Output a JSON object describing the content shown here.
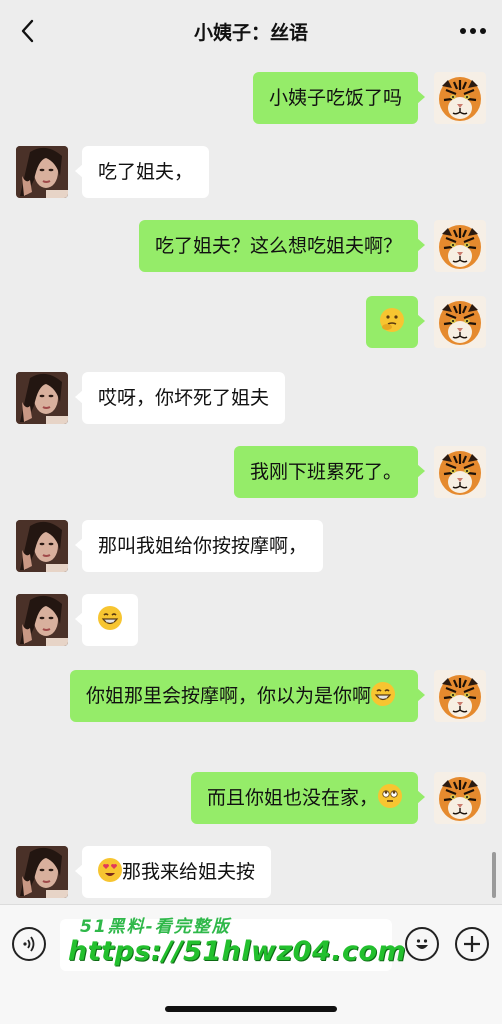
{
  "header": {
    "title": "小姨子：丝语",
    "back_icon": "chevron-left-icon",
    "more_icon": "more-dots-icon"
  },
  "messages": [
    {
      "side": "out",
      "text": "小姨子吃饭了吗"
    },
    {
      "side": "in",
      "text": "吃了姐夫，"
    },
    {
      "side": "out",
      "text": "吃了姐夫？这么想吃姐夫啊？"
    },
    {
      "side": "out",
      "text": "",
      "emoji": "thinking-face-emoji"
    },
    {
      "side": "in",
      "text": "哎呀，你坏死了姐夫"
    },
    {
      "side": "out",
      "text": "我刚下班累死了。"
    },
    {
      "side": "in",
      "text": "那叫我姐给你按按摩啊，"
    },
    {
      "side": "in",
      "text": "",
      "emoji": "grinning-face-emoji"
    },
    {
      "side": "out",
      "text": "你姐那里会按摩啊，你以为是你啊",
      "emoji": "grinning-face-emoji"
    },
    {
      "side": "out",
      "text": "而且你姐也没在家，",
      "emoji": "rolling-eyes-emoji"
    },
    {
      "side": "in",
      "text": "那我来给姐夫按",
      "emoji": "heart-eyes-emoji"
    }
  ],
  "footer": {
    "voice_icon": "voice-icon",
    "emoji_icon": "smiley-icon",
    "plus_icon": "plus-icon",
    "watermark_line1": "51黑料-看完整版",
    "watermark_line2": "https://51hlwz04.com"
  },
  "colors": {
    "background": "#ededed",
    "out_bubble": "#95ec69",
    "in_bubble": "#ffffff",
    "watermark": "#23c02e"
  }
}
